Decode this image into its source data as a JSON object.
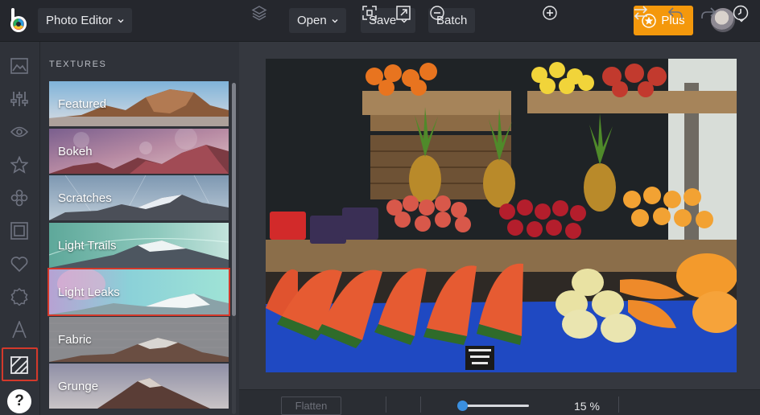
{
  "app": {
    "mode_label": "Photo Editor"
  },
  "toolbar": {
    "open_label": "Open",
    "save_label": "Save",
    "batch_label": "Batch",
    "plus_label": "Plus"
  },
  "panel": {
    "title": "TEXTURES",
    "items": [
      {
        "label": "Featured",
        "selected": false
      },
      {
        "label": "Bokeh",
        "selected": false
      },
      {
        "label": "Scratches",
        "selected": false
      },
      {
        "label": "Light Trails",
        "selected": false
      },
      {
        "label": "Light Leaks",
        "selected": true
      },
      {
        "label": "Fabric",
        "selected": false
      },
      {
        "label": "Grunge",
        "selected": false
      }
    ]
  },
  "rail": {
    "icons": [
      "image-icon",
      "sliders-icon",
      "eye-icon",
      "star-icon",
      "shapes-icon",
      "frame-icon",
      "heart-icon",
      "badge-icon",
      "text-icon",
      "textures-icon"
    ],
    "active": "textures-icon",
    "help_label": "?"
  },
  "bottom": {
    "flatten_label": "Flatten",
    "zoom_percent": 15,
    "zoom_label": "15 %"
  },
  "colors": {
    "accent": "#f4980c",
    "selection": "#d4392b",
    "slider": "#3a8fe0"
  }
}
